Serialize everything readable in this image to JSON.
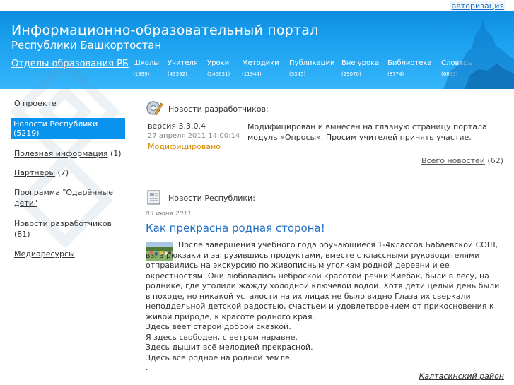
{
  "header": {
    "auth_link": "авторизация",
    "title": "Информационно-образовательный портал",
    "subtitle": "Республики Башкортостан",
    "dept_link": "Отделы образования РБ",
    "menu": [
      {
        "label": "Школы",
        "count": "(1999)"
      },
      {
        "label": "Учителя",
        "count": "(43392)"
      },
      {
        "label": "Уроки",
        "count": "(145631)"
      },
      {
        "label": "Методики",
        "count": "(11944)"
      },
      {
        "label": "Публикации",
        "count": "(3345)"
      },
      {
        "label": "Вне урока",
        "count": "(29070)"
      },
      {
        "label": "Библиотека",
        "count": "(8774)"
      },
      {
        "label": "Словарь",
        "count": "(6893)"
      }
    ]
  },
  "sidebar": {
    "items": [
      {
        "label": "О проекте",
        "count": ""
      },
      {
        "label": "Новости Республики",
        "count": "(5219)"
      },
      {
        "label": "Полезная информация",
        "count": " (1)"
      },
      {
        "label": "Партнёры",
        "count": " (7)"
      },
      {
        "label": "Программа \"Одарённые дети\"",
        "count": ""
      },
      {
        "label": "Новости разработчиков",
        "count": "(81)"
      },
      {
        "label": "Медиаресурсы",
        "count": ""
      }
    ]
  },
  "dev_news": {
    "heading": "Новости разработчиков:",
    "version": "версия 3.3.0.4",
    "date": "27 апреля 2011 14:00:14",
    "status": "Модифицировано",
    "text": "Модифицирован и вынесен на главную страницу портала модуль «Опросы». Просим учителей принять участие.",
    "all_news_label": "Всего новостей",
    "all_news_count": " (62)"
  },
  "republic_news": {
    "heading": "Новости Республики:",
    "date": "03 июня 2011",
    "title": "Как прекрасна родная сторона!",
    "paragraph": "После завершения учебного года обучающиеся  1-4классов Бабаевской СОШ, взяв рюкзаки и  загрузившись продуктами, вместе с классными руководителями отправились на экскурсию по       живописным уголкам    родной деревни и ее окрестностям  .Они любовались     неброской красотой речки Киебак, были в      лесу, на роднике, где утолили жажду холодной  ключевой водой. Хотя  дети целый день  были в походе, но никакой усталости на их           лицах не было видно   Глаза их           сверкали неподдельной детской  радостью, счастьем   и  удовлетворением от прикосновения к живой природе, к красоте родного края.",
    "poem": [
      "Здесь веет старой доброй сказкой.",
      "Я здесь свободен, с ветром наравне.",
      "Здесь дышит всё мелодией прекрасной.",
      "Здесь всё родное на родной земле.",
      "."
    ],
    "region": "Калтасинский район"
  },
  "colors": {
    "header_blue": "#1aa0ef",
    "active_item": "#0a93ee",
    "link_blue": "#1f6fc6",
    "status_orange": "#d28a00"
  }
}
